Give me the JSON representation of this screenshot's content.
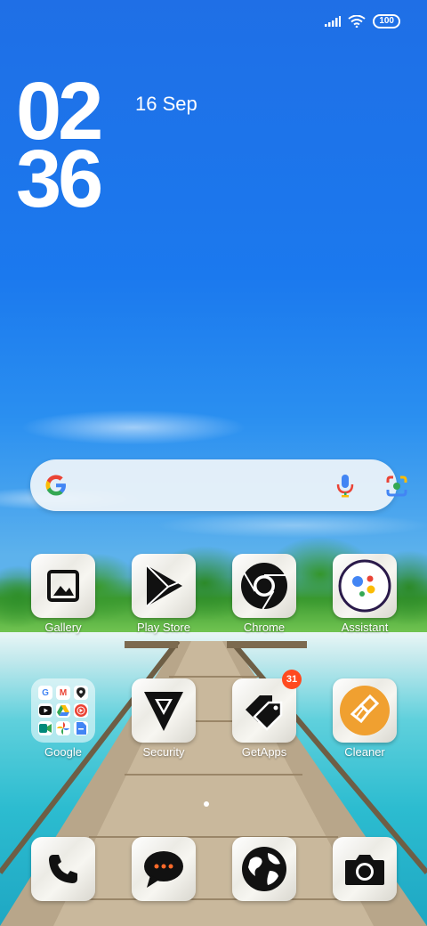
{
  "status_bar": {
    "battery": "100",
    "signal_icon": "signal-icon",
    "wifi_icon": "wifi-icon"
  },
  "clock": {
    "hours": "02",
    "minutes": "36",
    "date": "16 Sep"
  },
  "search": {
    "google_icon": "google-g-icon",
    "mic_icon": "mic-icon",
    "lens_icon": "lens-icon"
  },
  "apps_row1": [
    {
      "label": "Gallery",
      "icon": "gallery-icon"
    },
    {
      "label": "Play Store",
      "icon": "play-store-icon"
    },
    {
      "label": "Chrome",
      "icon": "chrome-icon"
    },
    {
      "label": "Assistant",
      "icon": "assistant-icon"
    }
  ],
  "apps_row2": [
    {
      "label": "Google",
      "icon": "folder-icon"
    },
    {
      "label": "Security",
      "icon": "security-icon"
    },
    {
      "label": "GetApps",
      "icon": "getapps-icon",
      "badge": "31"
    },
    {
      "label": "Cleaner",
      "icon": "cleaner-icon"
    }
  ],
  "dock": [
    {
      "icon": "phone-icon"
    },
    {
      "icon": "messages-icon"
    },
    {
      "icon": "browser-globe-icon"
    },
    {
      "icon": "camera-icon"
    }
  ],
  "colors": {
    "badge": "#ff4a1f",
    "cleaner_orange": "#f0a030"
  }
}
